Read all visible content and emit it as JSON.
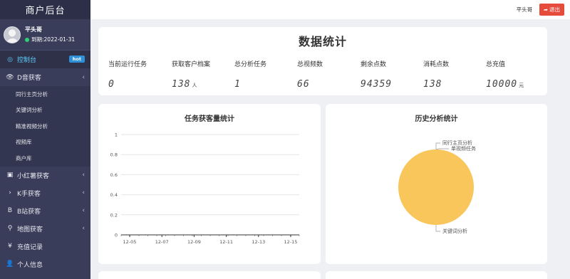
{
  "sidebar": {
    "title": "商户后台",
    "user": {
      "name": "平头哥",
      "status": "到期:2022-01-31"
    },
    "menu": [
      {
        "icon": "dashboard-icon",
        "glyph": "◎",
        "label": "控制台",
        "badge": "hot",
        "active": true
      },
      {
        "icon": "eye-icon",
        "glyph": "👁",
        "label": "D音获客",
        "arrow": "‹"
      }
    ],
    "submenu": [
      "同行主页分析",
      "关键词分析",
      "精准视频分析",
      "视频库",
      "商户库"
    ],
    "menu2": [
      {
        "icon": "book-icon",
        "glyph": "▣",
        "label": "小红薯获客",
        "arrow": "‹"
      },
      {
        "icon": "chevron-right-icon",
        "glyph": "›",
        "label": "K手获客",
        "arrow": "‹"
      },
      {
        "icon": "bold-b-icon",
        "glyph": "B",
        "label": "B站获客",
        "arrow": "‹"
      },
      {
        "icon": "map-pin-icon",
        "glyph": "⚲",
        "label": "地图获客",
        "arrow": "‹"
      },
      {
        "icon": "yen-icon",
        "glyph": "¥",
        "label": "充值记录"
      },
      {
        "icon": "user-icon",
        "glyph": "👤",
        "label": "个人信息"
      }
    ]
  },
  "topbar": {
    "user": "平头哥",
    "logout": "退出"
  },
  "stats": {
    "title": "数据统计",
    "items": [
      {
        "label": "当前运行任务",
        "value": "0",
        "unit": ""
      },
      {
        "label": "获取客户档案",
        "value": "138",
        "unit": "人"
      },
      {
        "label": "总分析任务",
        "value": "1",
        "unit": ""
      },
      {
        "label": "总视频数",
        "value": "66",
        "unit": ""
      },
      {
        "label": "剩余点数",
        "value": "94359",
        "unit": ""
      },
      {
        "label": "消耗点数",
        "value": "138",
        "unit": ""
      },
      {
        "label": "总充值",
        "value": "10000",
        "unit": "元"
      }
    ]
  },
  "colors": {
    "sidebar": "#393d5a",
    "accent": "#5fd0ff",
    "logout": "#e64c3c",
    "pie": "#f8c65a"
  },
  "chart_data": [
    {
      "type": "line",
      "title": "任务获客量统计",
      "categories": [
        "12-05",
        "12-07",
        "12-09",
        "12-11",
        "12-13",
        "12-15"
      ],
      "series": [],
      "ylim": [
        0,
        1
      ],
      "yticks": [
        "1",
        "0.8",
        "0.6",
        "0.4",
        "0.2",
        "0"
      ],
      "grid": true
    },
    {
      "type": "pie",
      "title": "历史分析统计",
      "labels": [
        "同行主页分析",
        "单视频任务",
        "关键词分析"
      ],
      "values": [
        0,
        0,
        1
      ]
    }
  ]
}
